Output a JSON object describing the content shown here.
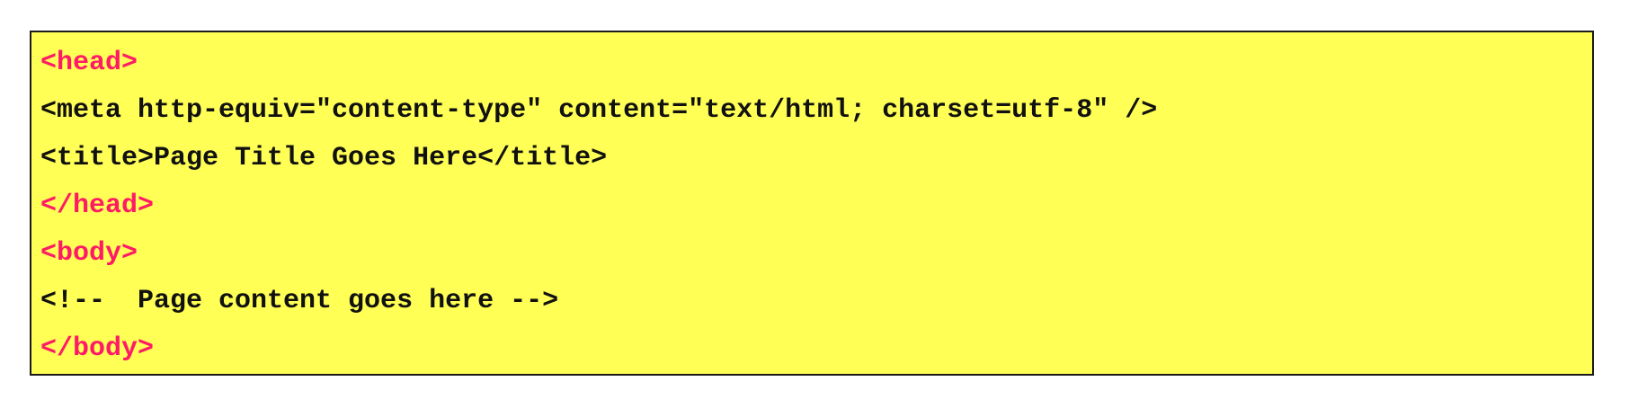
{
  "colors": {
    "background": "#ffff55",
    "border": "#1a1a1a",
    "tag_highlight": "#ff1a66",
    "text": "#111111"
  },
  "code": {
    "lines": [
      {
        "text": "<head>",
        "kind": "tag"
      },
      {
        "text": "<meta http-equiv=\"content-type\" content=\"text/html; charset=utf-8\" />",
        "kind": "plain"
      },
      {
        "text": "<title>Page Title Goes Here</title>",
        "kind": "plain"
      },
      {
        "text": "</head>",
        "kind": "tag"
      },
      {
        "text": "<body>",
        "kind": "tag"
      },
      {
        "text": "<!--  Page content goes here -->",
        "kind": "plain"
      },
      {
        "text": "</body>",
        "kind": "tag"
      }
    ]
  }
}
